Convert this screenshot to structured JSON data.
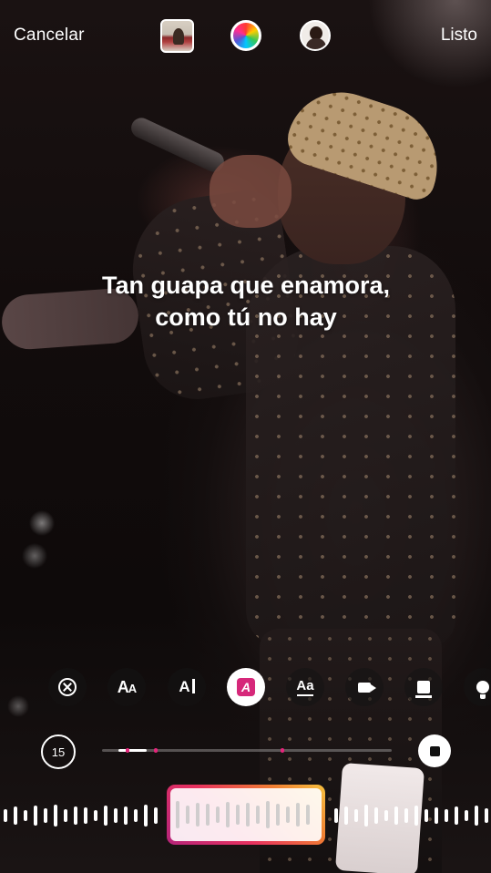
{
  "top_bar": {
    "cancel_label": "Cancelar",
    "done_label": "Listo",
    "thumbnail_icon": "album-thumbnail",
    "color_icon": "color-wheel",
    "avatar_icon": "profile-avatar"
  },
  "lyrics": {
    "text": "Tan guapa que enamora, como tú no hay"
  },
  "style_toolbar": {
    "items": [
      "remove-icon",
      "text-size-icon",
      "text-cursor-icon",
      "highlight-style-icon",
      "underline-text-icon",
      "video-icon",
      "card-icon",
      "bulb-icon"
    ],
    "selected_index": 3,
    "accent_color": "#d6287a"
  },
  "playback": {
    "duration_label": "15",
    "progress_fraction": 0.28,
    "stop_icon": "stop-icon"
  },
  "scrubber": {
    "gradient_colors": [
      "#b5247a",
      "#e8315f",
      "#f07d32",
      "#f7c23f"
    ]
  }
}
